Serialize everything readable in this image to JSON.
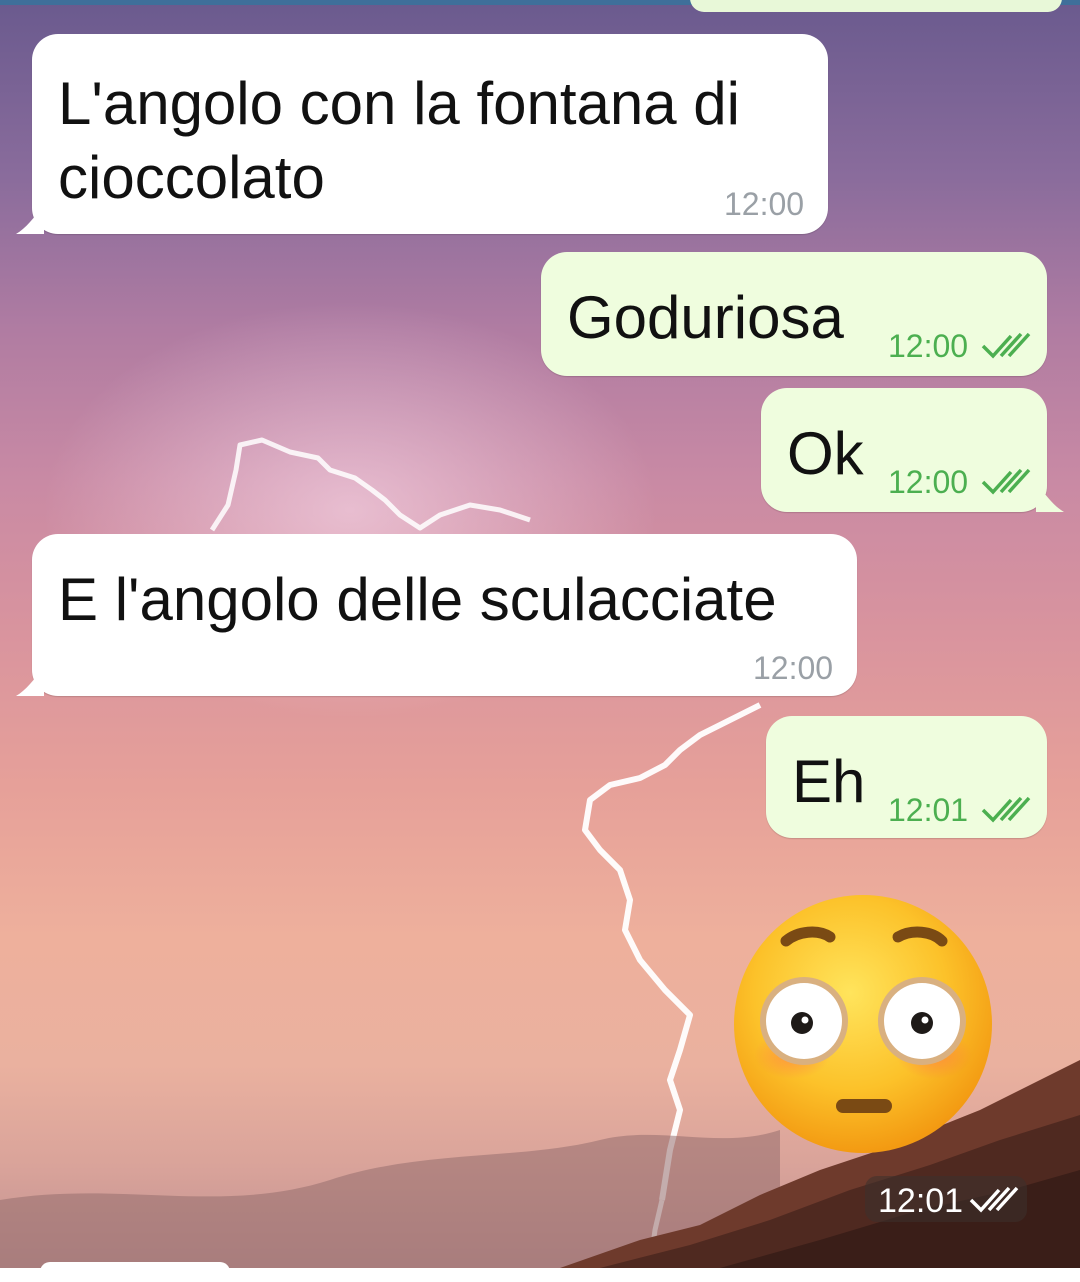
{
  "chat": {
    "messages": [
      {
        "direction": "incoming",
        "lines": [
          "L'angolo con la fontana di",
          "cioccolato"
        ],
        "time": "12:00"
      },
      {
        "direction": "outgoing",
        "text": "Goduriosa",
        "time": "12:00",
        "status": "read"
      },
      {
        "direction": "outgoing",
        "text": "Ok",
        "time": "12:00",
        "status": "read"
      },
      {
        "direction": "incoming",
        "text": "E l'angolo delle sculacciate",
        "time": "12:00"
      },
      {
        "direction": "outgoing",
        "text": "Eh",
        "time": "12:01",
        "status": "read"
      },
      {
        "direction": "outgoing",
        "type": "sticker",
        "sticker": "flushed-face-emoji",
        "time": "12:01",
        "status": "read"
      }
    ]
  },
  "colors": {
    "incoming_bubble": "#ffffff",
    "outgoing_bubble": "#effdde",
    "outgoing_time": "#4caf50",
    "incoming_time": "#9aa0a6",
    "top_bar": "#3f6f9a"
  },
  "icons": {
    "read_receipt": "double-check-icon",
    "wallpaper": "lightning-sunset-wallpaper"
  }
}
